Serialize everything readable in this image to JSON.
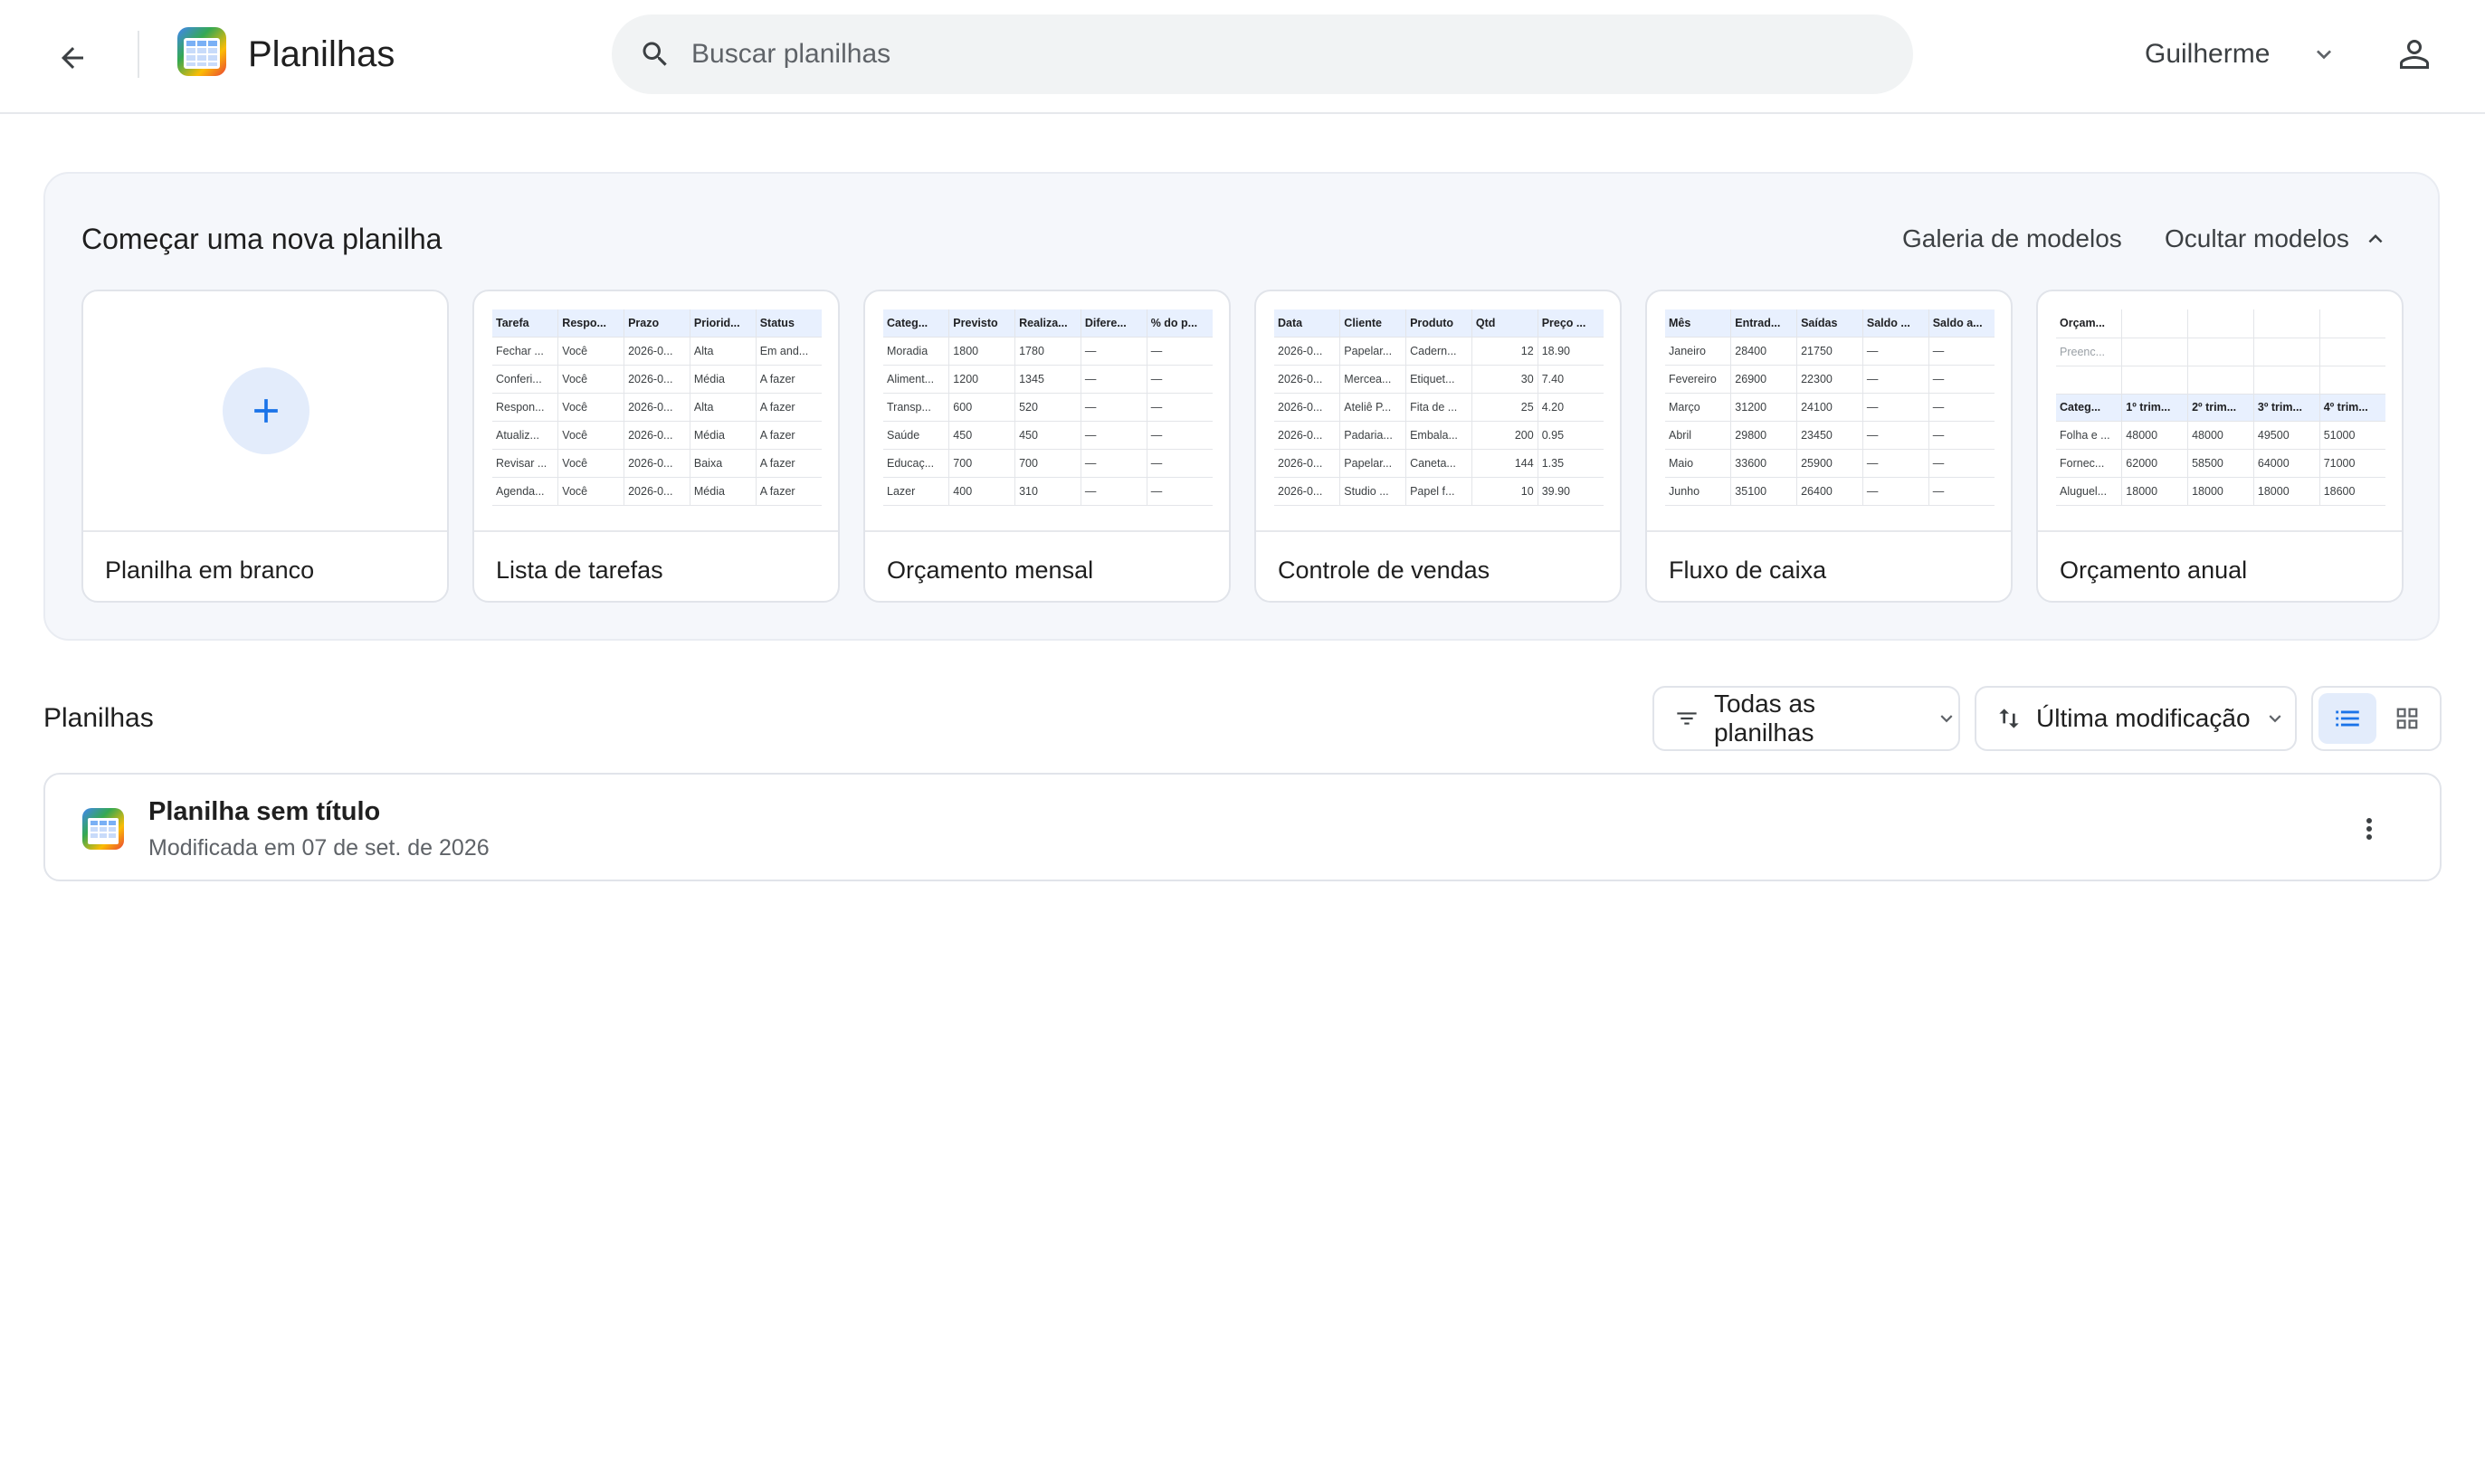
{
  "header": {
    "title": "Planilhas",
    "search_placeholder": "Buscar planilhas",
    "user_name": "Guilherme"
  },
  "templates": {
    "heading": "Começar uma nova planilha",
    "gallery_link": "Galeria de modelos",
    "hide_label": "Ocultar modelos",
    "cards": [
      {
        "label": "Planilha em branco"
      },
      {
        "label": "Lista de tarefas",
        "columns": [
          "Tarefa",
          "Respo...",
          "Prazo",
          "Priorid...",
          "Status"
        ],
        "rows": [
          [
            "Fechar ...",
            "Você",
            "2026-0...",
            "Alta",
            "Em and..."
          ],
          [
            "Conferi...",
            "Você",
            "2026-0...",
            "Média",
            "A fazer"
          ],
          [
            "Respon...",
            "Você",
            "2026-0...",
            "Alta",
            "A fazer"
          ],
          [
            "Atualiz...",
            "Você",
            "2026-0...",
            "Média",
            "A fazer"
          ],
          [
            "Revisar ...",
            "Você",
            "2026-0...",
            "Baixa",
            "A fazer"
          ],
          [
            "Agenda...",
            "Você",
            "2026-0...",
            "Média",
            "A fazer"
          ]
        ]
      },
      {
        "label": "Orçamento mensal",
        "columns": [
          "Categ...",
          "Previsto",
          "Realiza...",
          "Difere...",
          "% do p..."
        ],
        "rows": [
          [
            "Moradia",
            "1800",
            "1780",
            "—",
            "—"
          ],
          [
            "Aliment...",
            "1200",
            "1345",
            "—",
            "—"
          ],
          [
            "Transp...",
            "600",
            "520",
            "—",
            "—"
          ],
          [
            "Saúde",
            "450",
            "450",
            "—",
            "—"
          ],
          [
            "Educaç...",
            "700",
            "700",
            "—",
            "—"
          ],
          [
            "Lazer",
            "400",
            "310",
            "—",
            "—"
          ]
        ]
      },
      {
        "label": "Controle de vendas",
        "columns": [
          "Data",
          "Cliente",
          "Produto",
          "Qtd",
          "Preço ..."
        ],
        "rows": [
          [
            "2026-0...",
            "Papelar...",
            "Cadern...",
            "12",
            "18.90"
          ],
          [
            "2026-0...",
            "Mercea...",
            "Etiquet...",
            "30",
            "7.40"
          ],
          [
            "2026-0...",
            "Ateliê P...",
            "Fita de ...",
            "25",
            "4.20"
          ],
          [
            "2026-0...",
            "Padaria...",
            "Embala...",
            "200",
            "0.95"
          ],
          [
            "2026-0...",
            "Papelar...",
            "Caneta...",
            "144",
            "1.35"
          ],
          [
            "2026-0...",
            "Studio ...",
            "Papel f...",
            "10",
            "39.90"
          ]
        ]
      },
      {
        "label": "Fluxo de caixa",
        "columns": [
          "Mês",
          "Entrad...",
          "Saídas",
          "Saldo ...",
          "Saldo a..."
        ],
        "rows": [
          [
            "Janeiro",
            "28400",
            "21750",
            "—",
            "—"
          ],
          [
            "Fevereiro",
            "26900",
            "22300",
            "—",
            "—"
          ],
          [
            "Março",
            "31200",
            "24100",
            "—",
            "—"
          ],
          [
            "Abril",
            "29800",
            "23450",
            "—",
            "—"
          ],
          [
            "Maio",
            "33600",
            "25900",
            "—",
            "—"
          ],
          [
            "Junho",
            "35100",
            "26400",
            "—",
            "—"
          ]
        ]
      },
      {
        "label": "Orçamento anual",
        "top_rows": [
          [
            "Orçam...",
            "",
            "",
            "",
            ""
          ],
          [
            "Preenc...",
            "",
            "",
            "",
            ""
          ],
          [
            "",
            "",
            "",
            "",
            ""
          ]
        ],
        "columns": [
          "Categ...",
          "1º trim...",
          "2º trim...",
          "3º trim...",
          "4º trim..."
        ],
        "rows": [
          [
            "Folha e ...",
            "48000",
            "48000",
            "49500",
            "51000"
          ],
          [
            "Fornec...",
            "62000",
            "58500",
            "64000",
            "71000"
          ],
          [
            "Aluguel...",
            "18000",
            "18000",
            "18000",
            "18600"
          ]
        ]
      }
    ]
  },
  "files": {
    "title": "Planilhas",
    "filter_label": "Todas as planilhas",
    "sort_label": "Última modificação",
    "items": [
      {
        "name": "Planilha sem título",
        "meta": "Modificada em 07 de set. de 2026"
      }
    ]
  },
  "colors": {
    "accent": "#1a73e8",
    "template_bg": "#f5f7fb",
    "table_header_bg": "#e8f0fe"
  },
  "icons": [
    "back-arrow-icon",
    "sheets-logo-icon",
    "search-icon",
    "chevron-down-icon",
    "account-icon",
    "chevron-up-icon",
    "plus-icon",
    "filter-icon",
    "sort-icon",
    "list-view-icon",
    "grid-view-icon",
    "more-vert-icon"
  ]
}
